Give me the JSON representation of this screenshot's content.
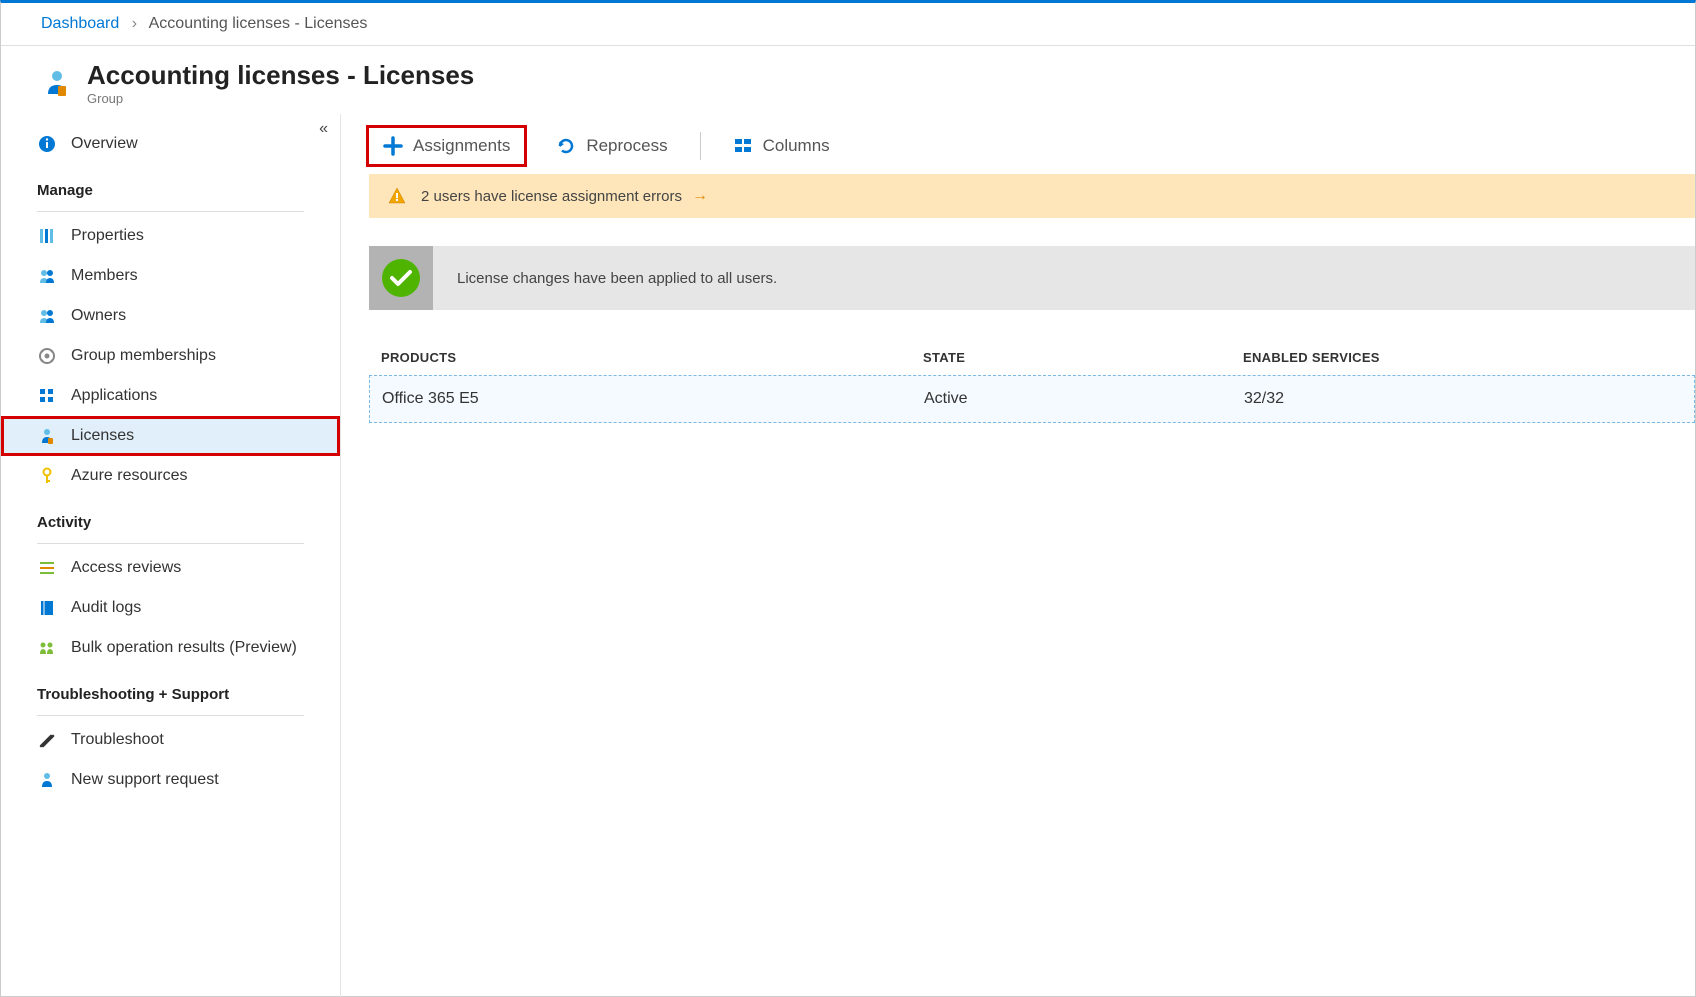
{
  "breadcrumb": {
    "root": "Dashboard",
    "current": "Accounting licenses - Licenses"
  },
  "header": {
    "title": "Accounting licenses - Licenses",
    "subtitle": "Group"
  },
  "sidebar": {
    "overview": "Overview",
    "sections": {
      "manage": "Manage",
      "activity": "Activity",
      "support": "Troubleshooting + Support"
    },
    "items": {
      "properties": "Properties",
      "members": "Members",
      "owners": "Owners",
      "groupMemberships": "Group memberships",
      "applications": "Applications",
      "licenses": "Licenses",
      "azureResources": "Azure resources",
      "accessReviews": "Access reviews",
      "auditLogs": "Audit logs",
      "bulkOps": "Bulk operation results (Preview)",
      "troubleshoot": "Troubleshoot",
      "newSupport": "New support request"
    }
  },
  "toolbar": {
    "assignments": "Assignments",
    "reprocess": "Reprocess",
    "columns": "Columns"
  },
  "warning": {
    "text": "2 users have license assignment errors"
  },
  "success": {
    "text": "License changes have been applied to all users."
  },
  "table": {
    "headers": {
      "products": "PRODUCTS",
      "state": "STATE",
      "services": "ENABLED SERVICES"
    },
    "row": {
      "product": "Office 365 E5",
      "state": "Active",
      "services": "32/32"
    }
  }
}
